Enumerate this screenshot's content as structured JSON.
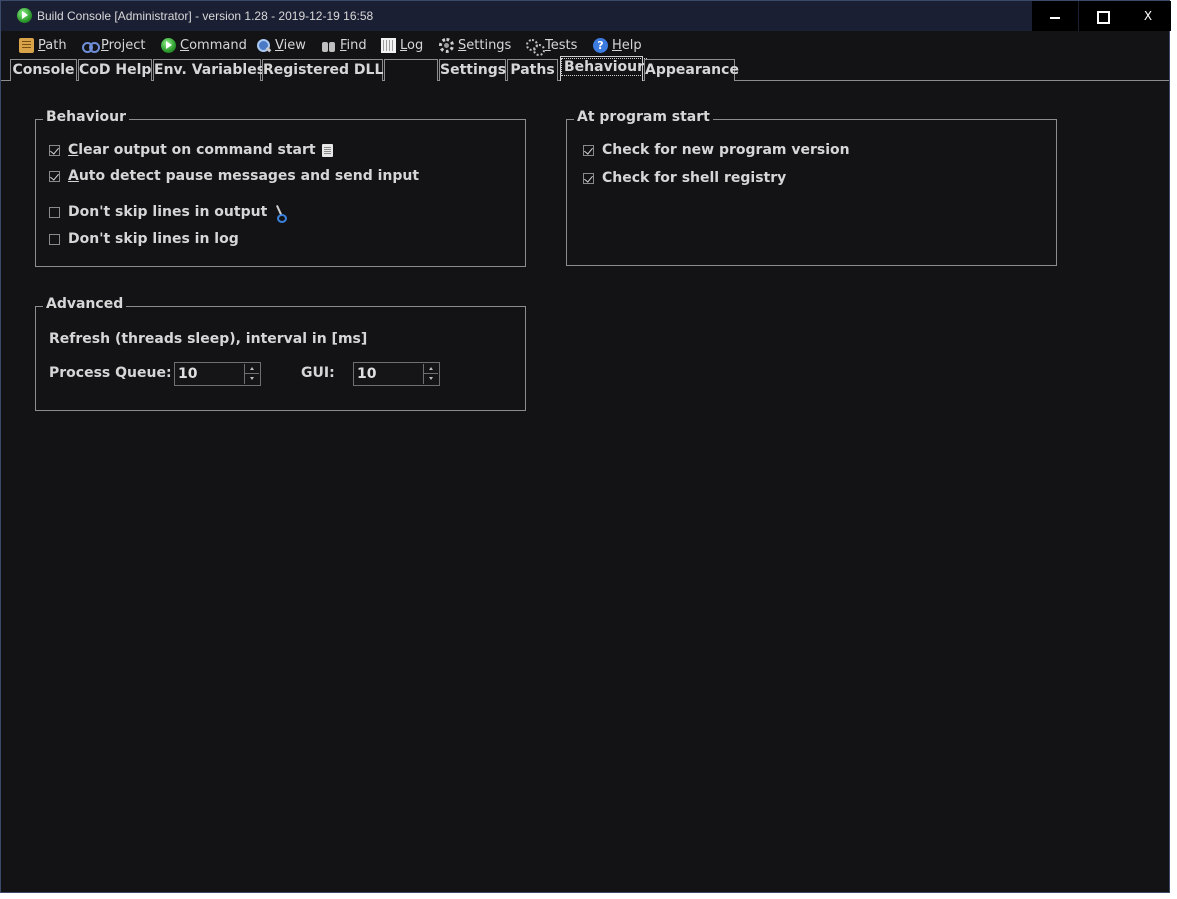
{
  "window": {
    "title": "Build Console [Administrator] - version 1.28 - 2019-12-19 16:58",
    "controls": {
      "minimize": "",
      "maximize": "",
      "close": "X"
    }
  },
  "menu": {
    "path": {
      "first": "P",
      "rest": "ath"
    },
    "project": {
      "first": "P",
      "rest": "roject"
    },
    "command": {
      "first": "C",
      "rest": "ommand"
    },
    "view": {
      "first": "V",
      "rest": "iew"
    },
    "find": {
      "first": "F",
      "rest": "ind"
    },
    "log": {
      "first": "L",
      "rest": "og"
    },
    "settings": {
      "first": "S",
      "rest": "ettings"
    },
    "tests": {
      "first": "T",
      "rest": "ests"
    },
    "help": {
      "first": "H",
      "rest": "elp"
    }
  },
  "tabs": {
    "console": "Console",
    "cod_help": "CoD Help",
    "env_variables": "Env. Variables",
    "registered_dlls": "Registered DLLs",
    "blank": "",
    "settings": "Settings",
    "paths": "Paths",
    "behaviour": "Behaviour",
    "appearance": "Appearance",
    "active": "Behaviour"
  },
  "behaviour_group": {
    "title": "Behaviour",
    "clear_output": {
      "first": "C",
      "rest": "lear output on command start",
      "checked": true
    },
    "auto_detect": {
      "first": "A",
      "rest": "uto detect pause messages and send input",
      "checked": true
    },
    "skip_output": {
      "label": "Don't skip lines in output",
      "checked": false
    },
    "skip_log": {
      "label": "Don't skip lines in log",
      "checked": false
    }
  },
  "program_start_group": {
    "title": "At program start",
    "check_version": {
      "label": "Check for new program version",
      "checked": true
    },
    "check_registry": {
      "label": "Check for shell registry",
      "checked": true
    }
  },
  "advanced_group": {
    "title": "Advanced",
    "refresh_label": "Refresh (threads sleep), interval in [ms]",
    "process_queue_label": "Process Queue:",
    "process_queue_value": "10",
    "gui_label": "GUI:",
    "gui_value": "10"
  },
  "colors": {
    "background": "#131316",
    "titlebar": "#1b1f33",
    "text": "#d6d6d6",
    "border": "#8d8d8d"
  }
}
